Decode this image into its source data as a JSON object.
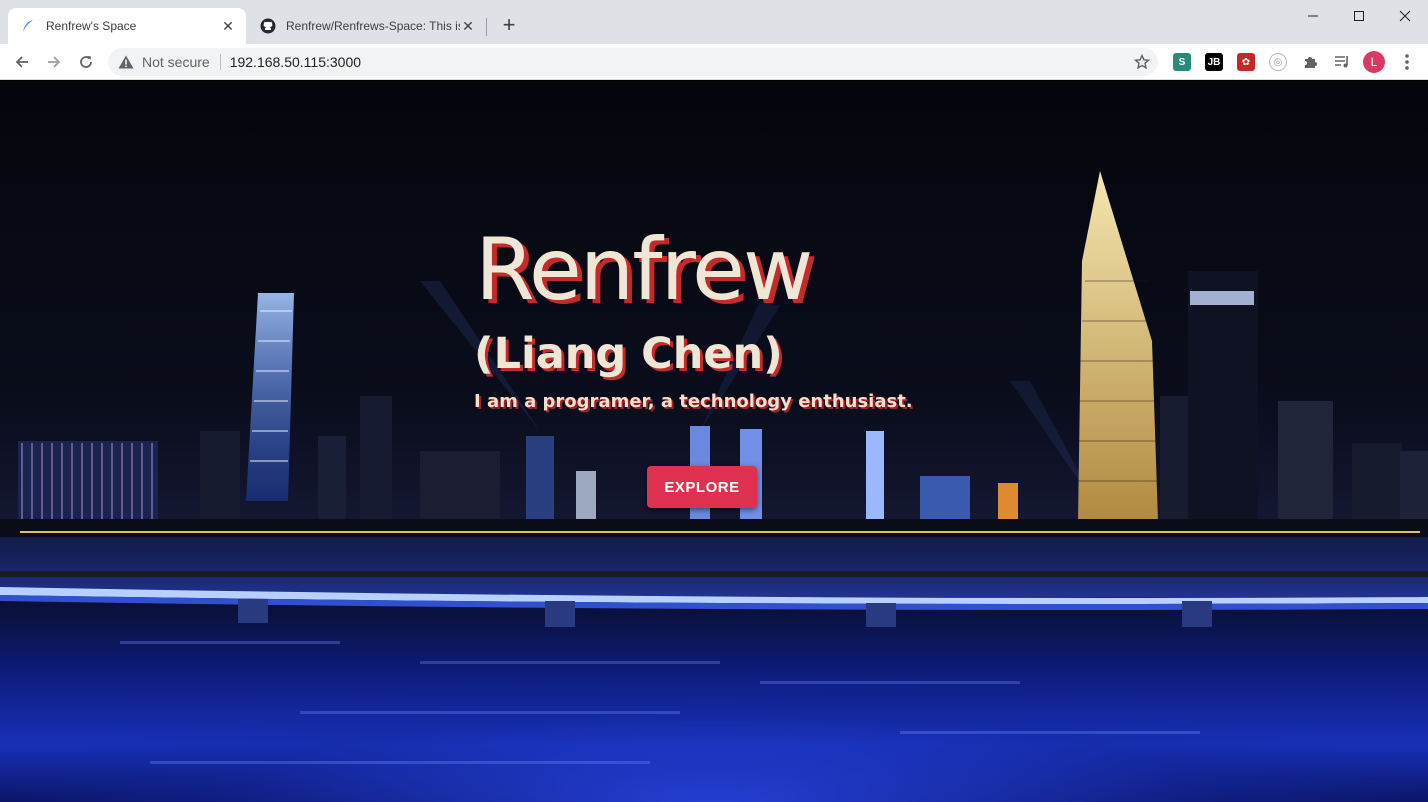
{
  "browser": {
    "tabs": [
      {
        "title": "Renfrew's Space",
        "active": true
      },
      {
        "title": "Renfrew/Renfrews-Space: This is",
        "active": false
      }
    ],
    "security_label": "Not secure",
    "url": "192.168.50.115:3000",
    "extensions": [
      "stylus-icon",
      "jetbrains-icon",
      "red-extension-icon",
      "circle-extension-icon",
      "puzzle-icon",
      "media-queue-icon"
    ],
    "profile_initial": "L",
    "colors": {
      "tabstrip": "#dee1e6",
      "avatar": "#d93964"
    }
  },
  "hero": {
    "name": "Renfrew",
    "real_name": "(Liang Chen)",
    "tagline": "I am a programer, a technology enthusiast.",
    "button_label": "EXPLORE",
    "colors": {
      "text": "#f0e6d6",
      "shadow": "#c42a2a",
      "button": "#e0304f"
    }
  }
}
